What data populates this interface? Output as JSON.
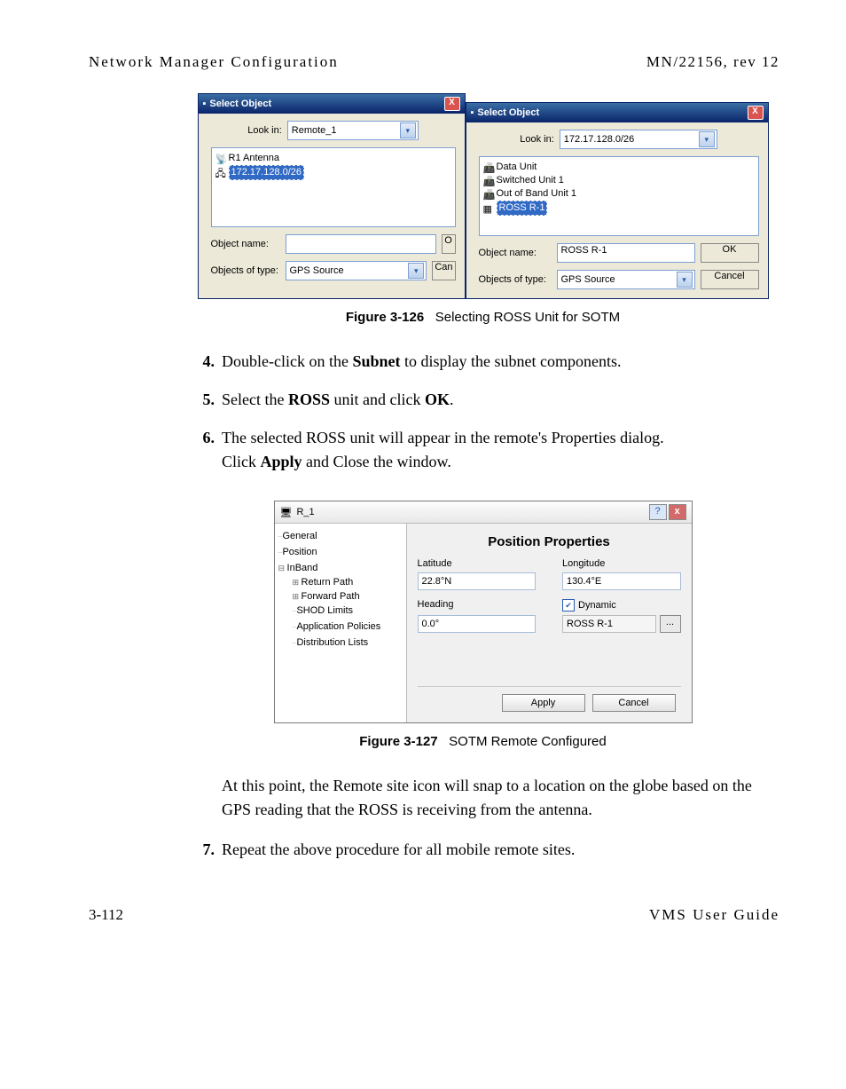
{
  "header": {
    "left": "Network Manager Configuration",
    "right": "MN/22156, rev 12"
  },
  "fig126": {
    "dialog1": {
      "title": "Select Object",
      "lookin_label": "Look in:",
      "lookin_value": "Remote_1",
      "tree": [
        "R1 Antenna",
        "172.17.128.0/26"
      ],
      "object_name_label": "Object name:",
      "object_name_value": "",
      "objects_of_type_label": "Objects of type:",
      "objects_of_type_value": "GPS Source",
      "btn_ok": "O",
      "btn_cancel": "Can"
    },
    "dialog2": {
      "title": "Select Object",
      "lookin_label": "Look in:",
      "lookin_value": "172.17.128.0/26",
      "tree": [
        "Data Unit",
        "Switched Unit 1",
        "Out of Band Unit 1",
        "ROSS R-1"
      ],
      "object_name_label": "Object name:",
      "object_name_value": "ROSS R-1",
      "objects_of_type_label": "Objects of type:",
      "objects_of_type_value": "GPS Source",
      "btn_ok": "OK",
      "btn_cancel": "Cancel"
    },
    "caption_bold": "Figure 3-126",
    "caption_rest": "Selecting ROSS Unit for SOTM"
  },
  "steps1": [
    {
      "num": "4.",
      "pre": "Double-click on the ",
      "bold": "Subnet",
      "post": " to display the subnet components."
    },
    {
      "num": "5.",
      "pre": "Select the ",
      "bold": "ROSS",
      "post": " unit and click ",
      "bold2": "OK",
      "post2": "."
    },
    {
      "num": "6.",
      "line1": "The selected ROSS unit will appear in the remote's Properties dialog.",
      "line2_pre": "Click ",
      "line2_bold": "Apply",
      "line2_post": " and Close the window."
    }
  ],
  "fig127": {
    "title": "R_1",
    "nav": [
      "General",
      "Position",
      "InBand",
      "Return Path",
      "Forward Path",
      "SHOD Limits",
      "Application Policies",
      "Distribution Lists"
    ],
    "heading": "Position Properties",
    "lat_label": "Latitude",
    "lat_value": "22.8°N",
    "lon_label": "Longitude",
    "lon_value": "130.4°E",
    "head_label": "Heading",
    "head_value": "0.0°",
    "dyn_label": "Dynamic",
    "ross_value": "ROSS R-1",
    "ellipsis": "...",
    "btn_apply": "Apply",
    "btn_cancel": "Cancel",
    "caption_bold": "Figure 3-127",
    "caption_rest": "SOTM Remote Configured"
  },
  "para_after": "At this point, the Remote site icon will snap to a location on the globe based on the GPS reading that the ROSS is receiving from the antenna.",
  "steps2": [
    {
      "num": "7.",
      "text": "Repeat the above procedure for all mobile remote sites."
    }
  ],
  "footer": {
    "left": "3-112",
    "right": "VMS User Guide"
  }
}
